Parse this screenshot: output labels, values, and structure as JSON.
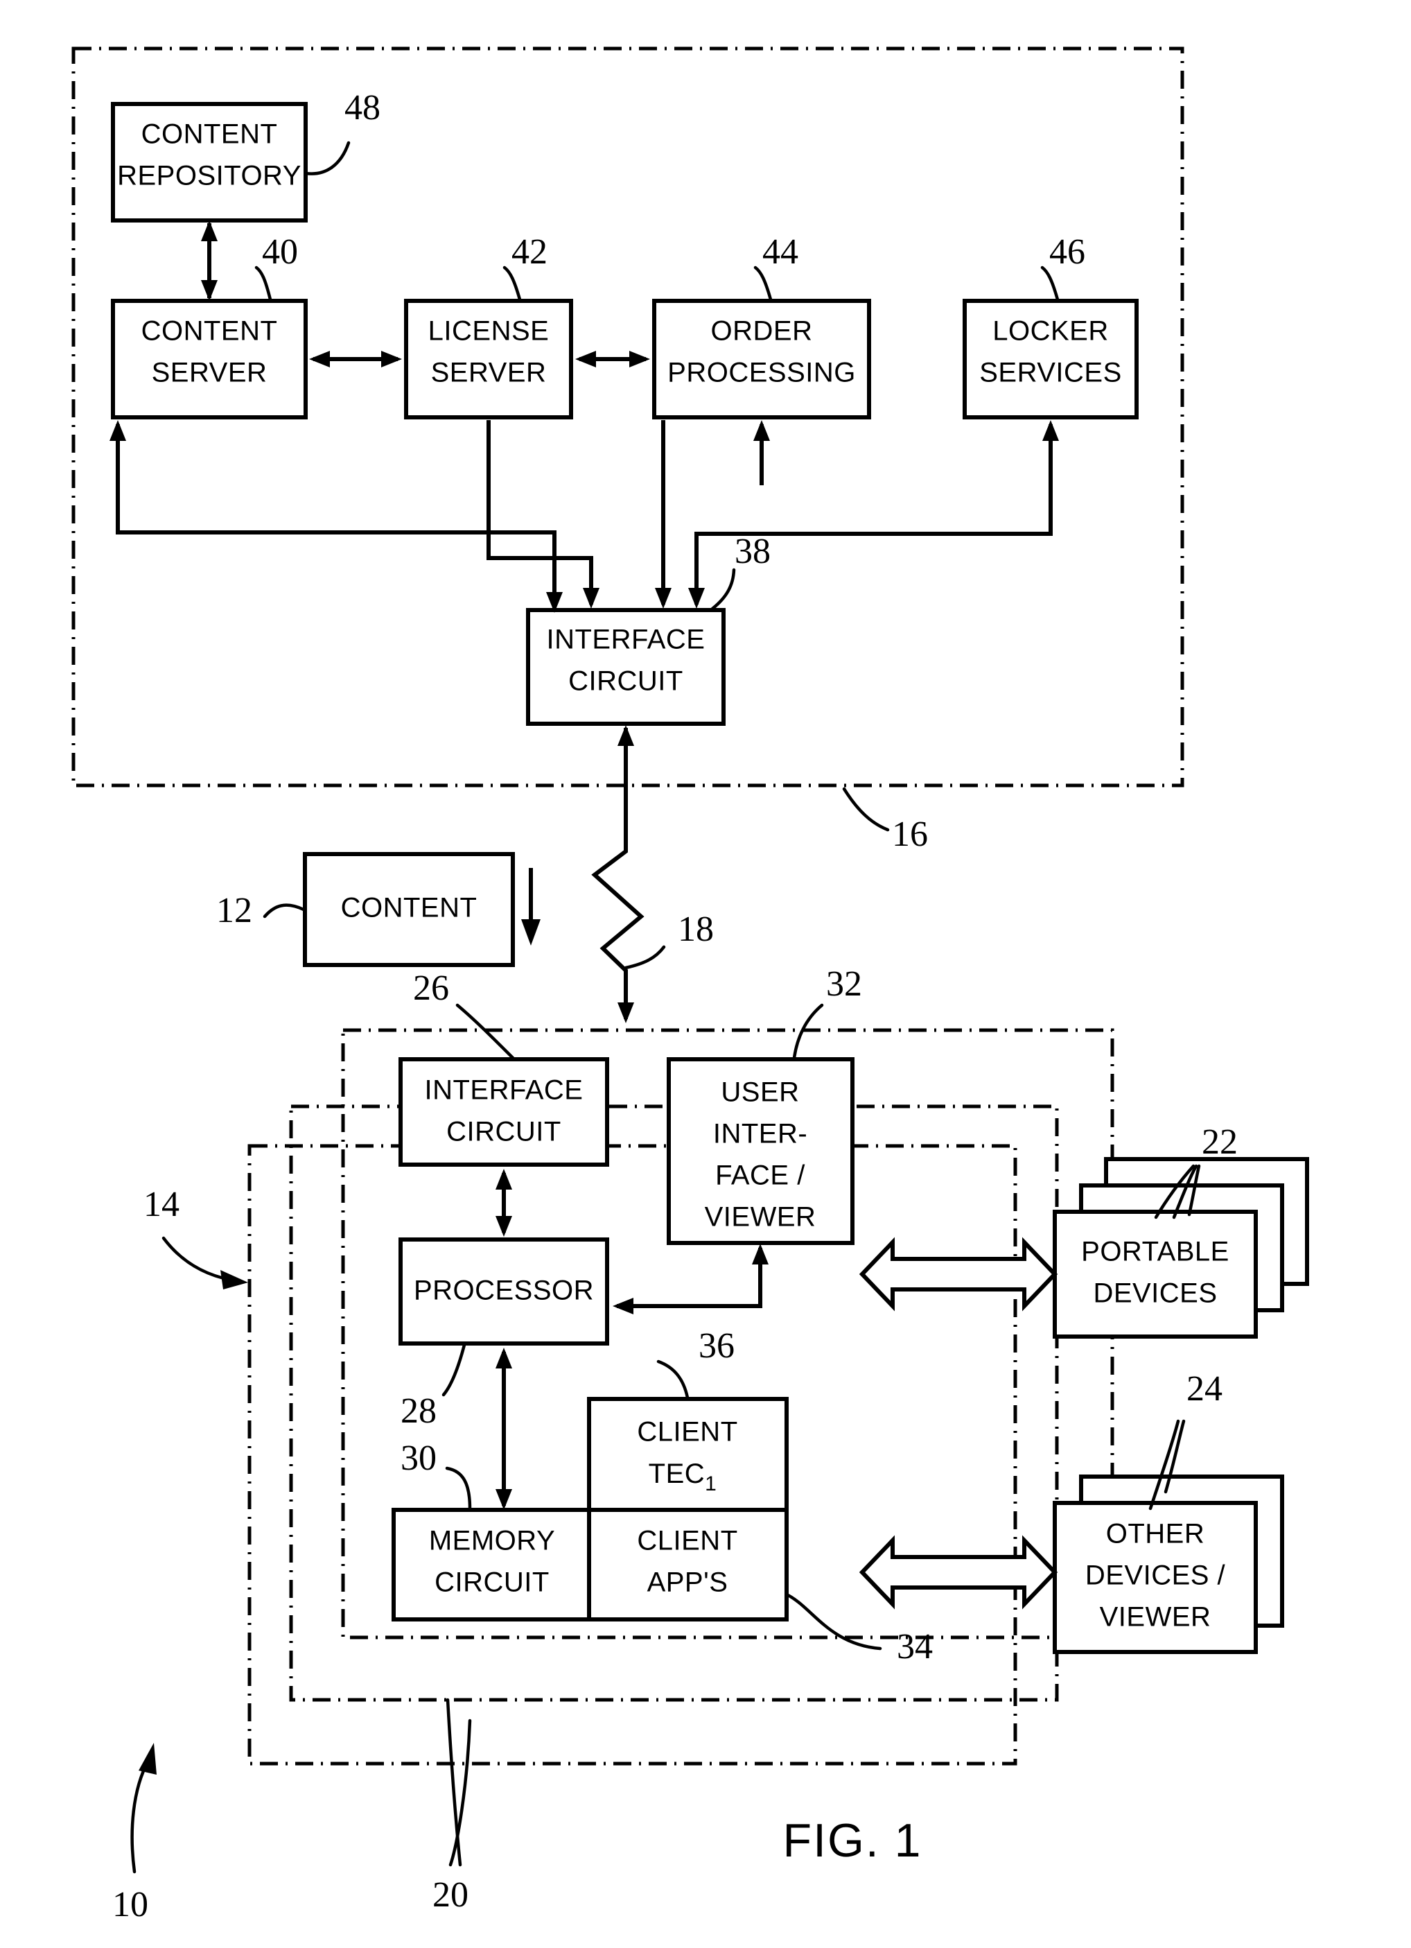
{
  "figure": {
    "caption": "FIG. 1",
    "system_ref": "10"
  },
  "server_domain": {
    "ref": "16",
    "boxes": [
      {
        "id": "content-repository",
        "ref": "48",
        "lines": [
          "CONTENT",
          "REPOSITORY"
        ]
      },
      {
        "id": "content-server",
        "ref": "40",
        "lines": [
          "CONTENT",
          "SERVER"
        ]
      },
      {
        "id": "license-server",
        "ref": "42",
        "lines": [
          "LICENSE",
          "SERVER"
        ]
      },
      {
        "id": "order-processing",
        "ref": "44",
        "lines": [
          "ORDER",
          "PROCESSING"
        ]
      },
      {
        "id": "locker-services",
        "ref": "46",
        "lines": [
          "LOCKER",
          "SERVICES"
        ]
      },
      {
        "id": "server-interface-circuit",
        "ref": "38",
        "lines": [
          "INTERFACE",
          "CIRCUIT"
        ]
      }
    ]
  },
  "network": {
    "ref": "18",
    "content_block": {
      "ref": "12",
      "lines": [
        "CONTENT"
      ]
    }
  },
  "client_domain": {
    "outer_ref": "14",
    "group_ref": "20",
    "client_apps_ref": "34",
    "boxes": [
      {
        "id": "client-interface-circuit",
        "ref": "26",
        "lines": [
          "INTERFACE",
          "CIRCUIT"
        ]
      },
      {
        "id": "user-interface-viewer",
        "ref": "32",
        "lines": [
          "USER",
          "INTER-",
          "FACE /",
          "VIEWER"
        ]
      },
      {
        "id": "processor",
        "ref": "28",
        "lines": [
          "PROCESSOR"
        ]
      },
      {
        "id": "memory-circuit",
        "ref": "30",
        "lines": [
          "MEMORY",
          "CIRCUIT"
        ]
      },
      {
        "id": "client-tec",
        "ref": "36",
        "lines": [
          "CLIENT",
          "TEC"
        ],
        "subscript": "1"
      },
      {
        "id": "client-apps",
        "ref": "34",
        "lines": [
          "CLIENT",
          "APP'S"
        ]
      }
    ]
  },
  "peripherals": [
    {
      "id": "portable-devices",
      "ref": "22",
      "lines": [
        "PORTABLE",
        "DEVICES"
      ],
      "stack": 3
    },
    {
      "id": "other-devices-viewer",
      "ref": "24",
      "lines": [
        "OTHER",
        "DEVICES /",
        "VIEWER"
      ],
      "stack": 2
    }
  ]
}
